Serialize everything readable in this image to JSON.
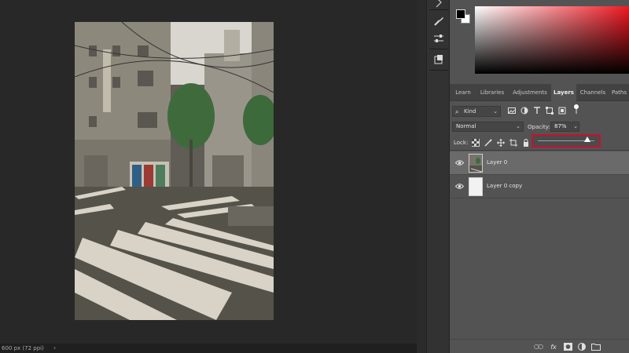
{
  "colors": {
    "accent_highlight": "#c8102e",
    "panel_bg": "#535353",
    "app_bg": "#282828",
    "picker_hue": "#f01822"
  },
  "status_bar": {
    "doc_info": "600 px (72 ppi)",
    "arrow": "›"
  },
  "swatches": {
    "foreground": "#000000",
    "background": "#ffffff"
  },
  "tabs": [
    {
      "label": "Learn",
      "active": false
    },
    {
      "label": "Libraries",
      "active": false
    },
    {
      "label": "Adjustments",
      "active": false
    },
    {
      "label": "Layers",
      "active": true
    },
    {
      "label": "Channels",
      "active": false
    },
    {
      "label": "Paths",
      "active": false
    }
  ],
  "layers_panel": {
    "filter_kind": "Kind",
    "blend_mode": "Normal",
    "opacity_label": "Opacity:",
    "opacity_value": "87%",
    "opacity_fraction": 0.87,
    "lock_label": "Lock:",
    "layers": [
      {
        "name": "Layer 0",
        "selected": true,
        "visible": true
      },
      {
        "name": "Layer 0 copy",
        "selected": false,
        "visible": true
      }
    ]
  },
  "icons": {
    "dock": [
      "brush-settings-icon",
      "adjust-sliders-icon",
      "3d-cube-icon"
    ],
    "filters": [
      "image-filter-icon",
      "adjustment-filter-icon",
      "type-filter-icon",
      "shape-filter-icon",
      "smart-object-filter-icon",
      "filter-toggle-icon"
    ],
    "locks": [
      "lock-transparency-icon",
      "lock-pixels-icon",
      "lock-position-icon",
      "lock-artboard-icon",
      "lock-all-icon"
    ],
    "bottom": [
      "link-layers-icon",
      "layer-style-icon",
      "add-mask-icon",
      "new-fill-adjustment-icon",
      "new-group-icon"
    ]
  }
}
